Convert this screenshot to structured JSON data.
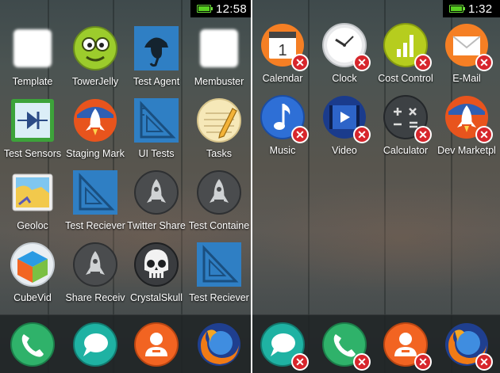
{
  "left_screen": {
    "status": {
      "time": "12:58",
      "battery_level": 1.0
    },
    "apps": [
      {
        "label": "Template",
        "icon": "blank-white-icon"
      },
      {
        "label": "TowerJelly",
        "icon": "tower-jelly-icon"
      },
      {
        "label": "Test Agent",
        "icon": "sherlock-agent-icon"
      },
      {
        "label": "Membuster",
        "icon": "blank-white-icon"
      },
      {
        "label": "Test Sensors",
        "icon": "diode-sensor-icon"
      },
      {
        "label": "Staging Mark",
        "icon": "rocket-marketplace-icon"
      },
      {
        "label": "UI Tests",
        "icon": "blue-triangle-ruler-icon"
      },
      {
        "label": "Tasks",
        "icon": "notepad-pencil-icon"
      },
      {
        "label": "Geoloc",
        "icon": "map-geoloc-icon"
      },
      {
        "label": "Test Reciever",
        "icon": "blue-triangle-ruler-icon"
      },
      {
        "label": "Twitter Share",
        "icon": "grey-rocket-icon"
      },
      {
        "label": "Test Containe",
        "icon": "grey-rocket-icon"
      },
      {
        "label": "CubeVid",
        "icon": "cube-video-icon"
      },
      {
        "label": "Share Receiv",
        "icon": "grey-rocket-icon"
      },
      {
        "label": "CrystalSkull",
        "icon": "crystal-skull-icon"
      },
      {
        "label": "Test Reciever",
        "icon": "blue-triangle-ruler-icon"
      }
    ],
    "dock": [
      {
        "name": "phone",
        "icon": "phone-icon"
      },
      {
        "name": "messages",
        "icon": "messages-icon"
      },
      {
        "name": "contacts",
        "icon": "contacts-icon"
      },
      {
        "name": "browser",
        "icon": "firefox-icon"
      }
    ]
  },
  "right_screen": {
    "status": {
      "time": "1:32",
      "battery_level": 1.0
    },
    "calendar_day": "1",
    "apps": [
      {
        "label": "Calendar",
        "icon": "calendar-icon"
      },
      {
        "label": "Clock",
        "icon": "clock-icon"
      },
      {
        "label": "Cost Control",
        "icon": "cost-control-icon"
      },
      {
        "label": "E-Mail",
        "icon": "email-icon"
      },
      {
        "label": "Music",
        "icon": "music-icon"
      },
      {
        "label": "Video",
        "icon": "video-icon"
      },
      {
        "label": "Calculator",
        "icon": "calculator-icon"
      },
      {
        "label": "Dev Marketpl",
        "icon": "rocket-marketplace-icon"
      }
    ],
    "dock": [
      {
        "name": "messages",
        "icon": "messages-icon"
      },
      {
        "name": "phone",
        "icon": "phone-icon"
      },
      {
        "name": "contacts",
        "icon": "contacts-icon"
      },
      {
        "name": "browser",
        "icon": "firefox-icon"
      }
    ],
    "delete_badge_symbol": "✕"
  },
  "colors": {
    "badge_red": "#d7262c",
    "battery_green": "#58d021",
    "ruler_blue": "#2f7fc4",
    "phone_green": "#2fb26a",
    "messages_teal": "#1fb2a3",
    "contacts_orange": "#f26422"
  }
}
